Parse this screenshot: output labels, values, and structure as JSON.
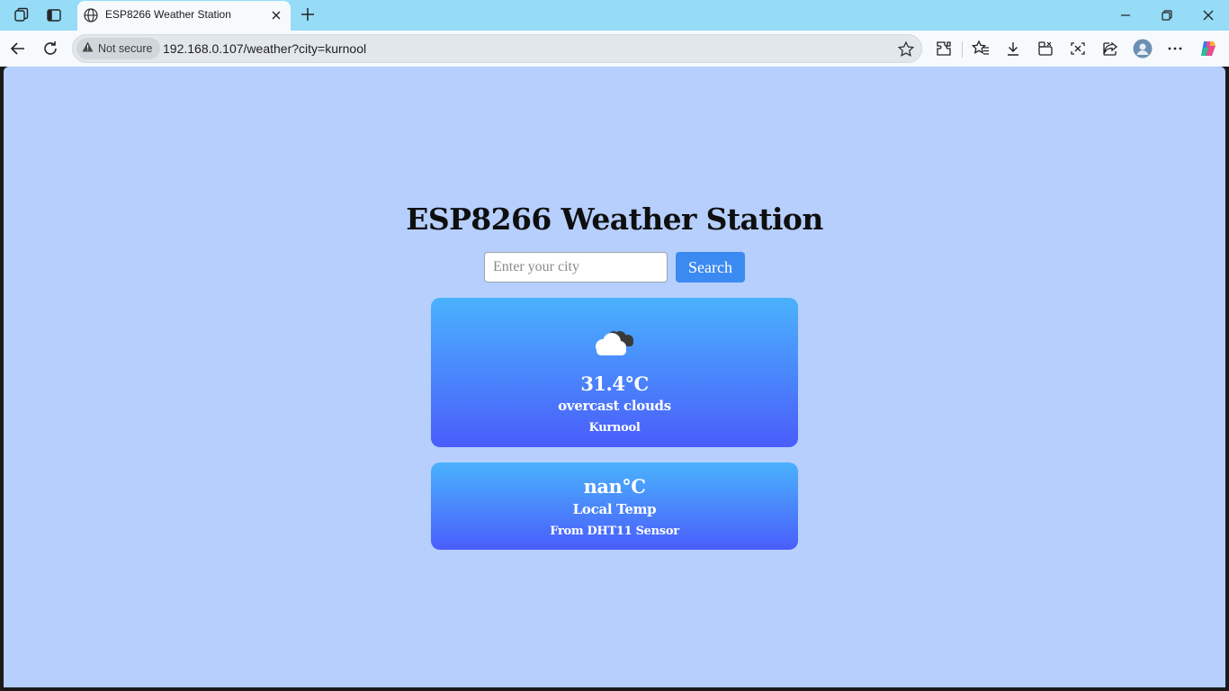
{
  "browser": {
    "tab_title": "ESP8266 Weather Station",
    "security_label": "Not secure",
    "url": "192.168.0.107/weather?city=kurnool",
    "icons": [
      "workspaces-icon",
      "vertical-tabs-icon",
      "globe-icon",
      "close-icon",
      "plus-icon",
      "minimize-icon",
      "restore-icon",
      "window-close-icon",
      "back-icon",
      "refresh-icon",
      "warning-icon",
      "favorite-star-icon",
      "extensions-icon",
      "favorites-icon",
      "download-icon",
      "collections-icon",
      "screenshot-icon",
      "share-icon",
      "profile-avatar",
      "more-icon",
      "copilot-icon"
    ]
  },
  "page": {
    "title": "ESP8266 Weather Station",
    "search_placeholder": "Enter your city",
    "search_button": "Search",
    "weather_card": {
      "icon": "overcast-clouds-icon",
      "temperature": "31.4°C",
      "description": "overcast clouds",
      "city": "Kurnool"
    },
    "local_card": {
      "temperature": "nan°C",
      "label": "Local Temp",
      "source": "From DHT11 Sensor"
    }
  },
  "colors": {
    "titlebar": "#96dcf7",
    "page_background": "#b6cffd",
    "search_button": "#3b8af2",
    "card_gradient_top": "#4ab2fc",
    "card_gradient_bottom": "#4a5dfb"
  }
}
